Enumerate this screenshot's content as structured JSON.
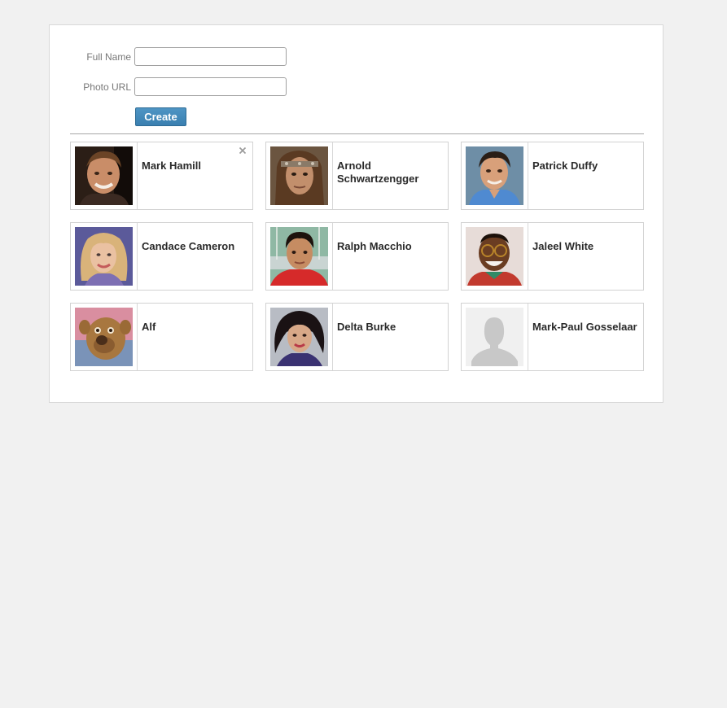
{
  "form": {
    "full_name_label": "Full Name",
    "full_name_value": "",
    "photo_url_label": "Photo URL",
    "photo_url_value": "",
    "create_label": "Create"
  },
  "people": [
    {
      "name": "Mark Hamill",
      "photo": "portrait-photo"
    },
    {
      "name": "Arnold Schwartzengger",
      "photo": "portrait-photo"
    },
    {
      "name": "Patrick Duffy",
      "photo": "portrait-photo"
    },
    {
      "name": "Candace Cameron",
      "photo": "portrait-photo"
    },
    {
      "name": "Ralph Macchio",
      "photo": "portrait-photo"
    },
    {
      "name": "Jaleel White",
      "photo": "portrait-photo"
    },
    {
      "name": "Alf",
      "photo": "portrait-photo"
    },
    {
      "name": "Delta Burke",
      "photo": "portrait-photo"
    },
    {
      "name": "Mark-Paul Gosselaar",
      "photo": "default-avatar-placeholder"
    }
  ],
  "icons": {
    "remove": "close-icon"
  },
  "colors": {
    "page_background": "#f1f1f1",
    "button_background": "#3f86b8",
    "card_border": "#d2d2d2"
  }
}
